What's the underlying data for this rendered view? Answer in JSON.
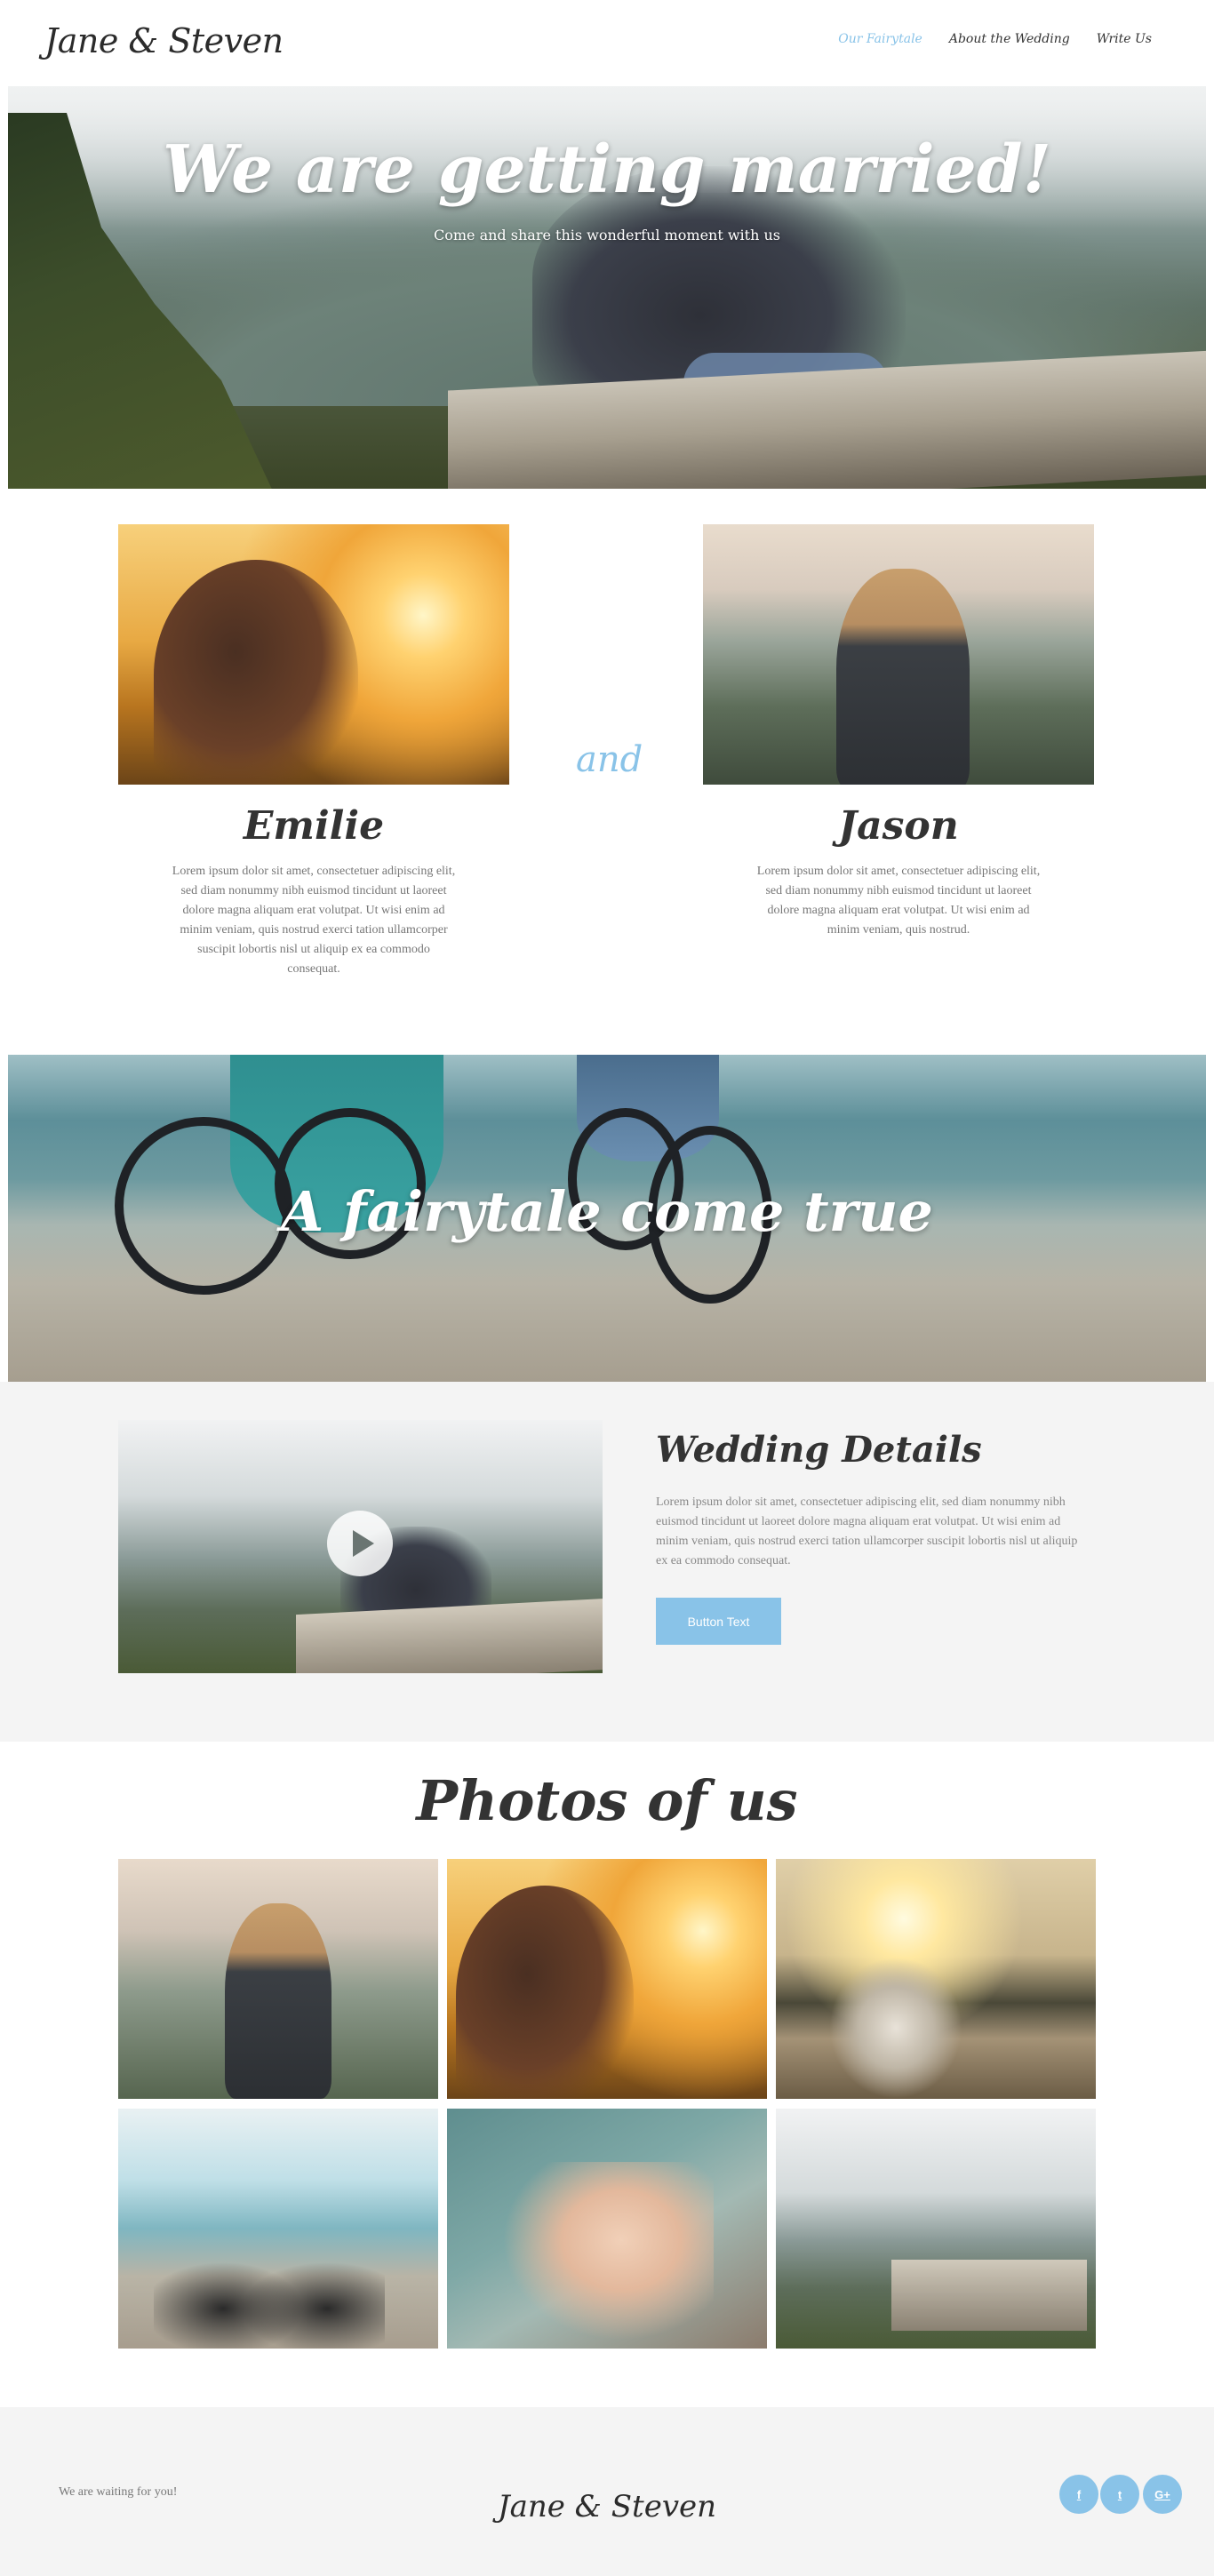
{
  "header": {
    "logo": "Jane & Steven",
    "nav": [
      {
        "label": "Our Fairytale",
        "active": true
      },
      {
        "label": "About the Wedding",
        "active": false
      },
      {
        "label": "Write Us",
        "active": false
      }
    ]
  },
  "hero": {
    "title": "We are getting married!",
    "subtitle": "Come and share this wonderful moment with us"
  },
  "couple": {
    "connector": "and",
    "bride": {
      "name": "Emilie",
      "bio": "Lorem ipsum dolor sit amet, consectetuer adipiscing elit, sed diam nonummy nibh euismod tincidunt ut laoreet dolore magna aliquam erat volutpat. Ut wisi enim ad minim veniam, quis nostrud exerci tation ullamcorper suscipit lobortis nisl ut aliquip ex ea commodo consequat."
    },
    "groom": {
      "name": "Jason",
      "bio": "Lorem ipsum dolor sit amet, consectetuer adipiscing elit, sed diam nonummy nibh euismod tincidunt ut laoreet dolore magna aliquam erat volutpat. Ut wisi enim ad minim veniam, quis nostrud."
    }
  },
  "band": {
    "title": "A fairytale come true"
  },
  "details": {
    "title": "Wedding Details",
    "text": "Lorem ipsum dolor sit amet, consectetuer adipiscing elit, sed diam nonummy nibh euismod tincidunt ut laoreet dolore magna aliquam erat volutpat. Ut wisi enim ad minim veniam, quis nostrud exerci tation ullamcorper suscipit lobortis nisl ut aliquip ex ea commodo consequat.",
    "button_label": "Button Text"
  },
  "gallery": {
    "title": "Photos of us"
  },
  "footer": {
    "tagline": "We are waiting for you!",
    "logo": "Jane & Steven",
    "social": [
      {
        "icon": "facebook-icon",
        "glyph": "f"
      },
      {
        "icon": "twitter-icon",
        "glyph": "t"
      },
      {
        "icon": "google-plus-icon",
        "glyph": "G+"
      }
    ]
  },
  "colors": {
    "accent": "#89c3e8",
    "footer_bg": "#f4f4f4"
  }
}
